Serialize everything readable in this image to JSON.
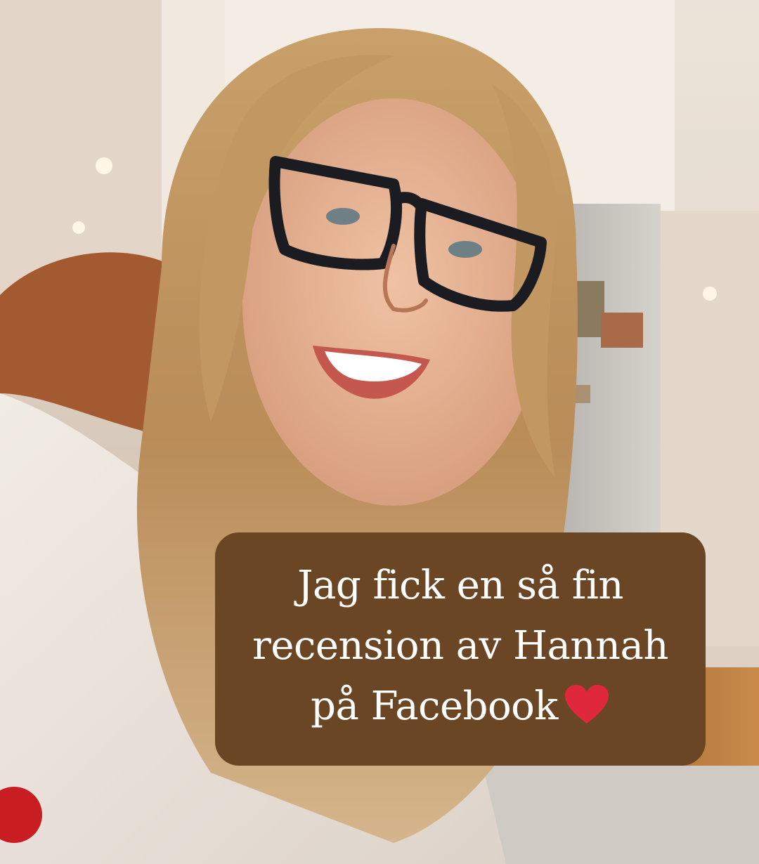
{
  "caption": {
    "line1": "Jag fick en så fin",
    "line2": "recension av Hannah",
    "line3": "på Facebook",
    "heart_icon": "heart-icon",
    "box_color": "#6b4624",
    "text_color": "#ffffff",
    "heart_color": "#e0283c"
  }
}
